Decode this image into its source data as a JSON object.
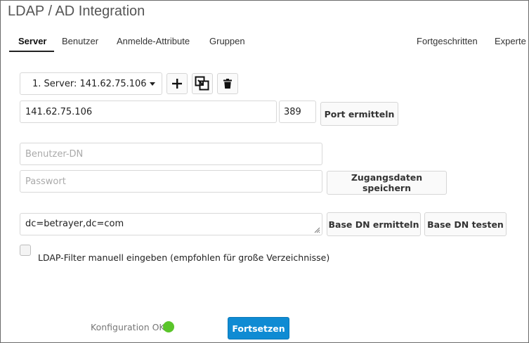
{
  "app": {
    "title": "LDAP / AD Integration"
  },
  "tabs": [
    {
      "label": "Server",
      "active": true
    },
    {
      "label": "Benutzer",
      "active": false
    },
    {
      "label": "Anmelde-Attribute",
      "active": false
    },
    {
      "label": "Gruppen",
      "active": false
    },
    {
      "label": "Fortgeschritten",
      "active": false
    },
    {
      "label": "Experte",
      "active": false
    }
  ],
  "server": {
    "selected": "1. Server: 141.62.75.106",
    "add_icon": "plus-icon",
    "copy_icon": "copy-config-icon",
    "delete_icon": "trash-icon",
    "host_value": "141.62.75.106",
    "port_value": "389",
    "detect_port_label": "Port ermitteln"
  },
  "credentials": {
    "user_dn_placeholder": "Benutzer-DN",
    "user_dn_value": "",
    "password_placeholder": "Passwort",
    "password_value": "",
    "save_label": "Zugangsdaten speichern"
  },
  "base_dn": {
    "value": "dc=betrayer,dc=com",
    "detect_label": "Base DN ermitteln",
    "test_label": "Base DN testen"
  },
  "filter": {
    "checked": false,
    "label": "LDAP-Filter manuell eingeben (empfohlen für große Verzeichnisse)"
  },
  "footer": {
    "status_text": "Konfiguration OK",
    "status_color": "#5ac52a",
    "continue_label": "Fortsetzen",
    "accent": "#0f8bd3"
  }
}
